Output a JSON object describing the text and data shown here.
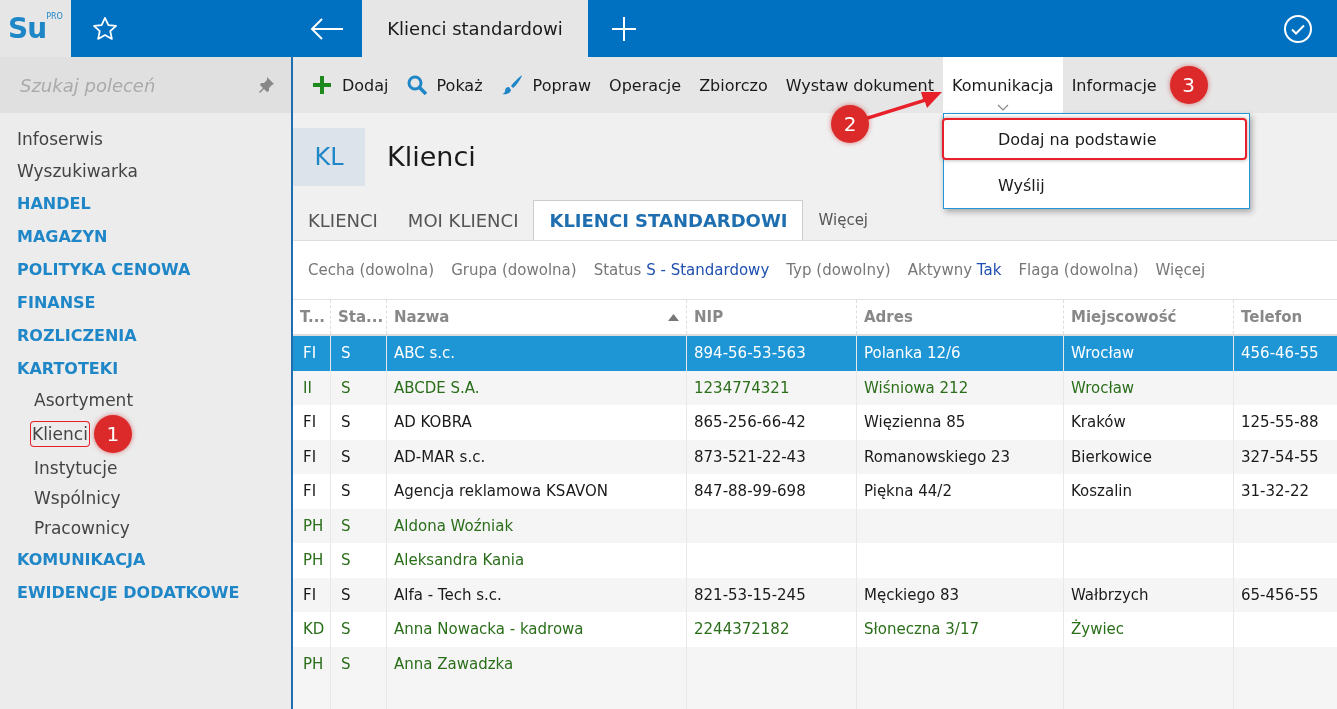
{
  "app": {
    "logo": "Su",
    "logo_sup": "PRO"
  },
  "top_tab": {
    "title": "Klienci standardowi"
  },
  "sidebar": {
    "search": {
      "placeholder": "Szukaj poleceń"
    },
    "items": [
      {
        "kind": "link",
        "label": "Infoserwis"
      },
      {
        "kind": "link",
        "label": "Wyszukiwarka"
      },
      {
        "kind": "group",
        "label": "HANDEL"
      },
      {
        "kind": "group",
        "label": "MAGAZYN"
      },
      {
        "kind": "group",
        "label": "POLITYKA CENOWA"
      },
      {
        "kind": "group",
        "label": "FINANSE"
      },
      {
        "kind": "group",
        "label": "ROZLICZENIA"
      },
      {
        "kind": "group",
        "label": "KARTOTEKI",
        "children": [
          {
            "kind": "link",
            "label": "Asortyment",
            "highlighted": false
          },
          {
            "kind": "link",
            "label": "Klienci",
            "highlighted": true,
            "step": "1"
          },
          {
            "kind": "link",
            "label": "Instytucje",
            "highlighted": false
          },
          {
            "kind": "link",
            "label": "Wspólnicy",
            "highlighted": false
          },
          {
            "kind": "link",
            "label": "Pracownicy",
            "highlighted": false
          }
        ]
      },
      {
        "kind": "group",
        "label": "KOMUNIKACJA"
      },
      {
        "kind": "group",
        "label": "EWIDENCJE DODATKOWE"
      }
    ]
  },
  "toolbar": [
    {
      "label": "Dodaj",
      "open": false
    },
    {
      "label": "Pokaż",
      "open": false
    },
    {
      "label": "Popraw",
      "open": false
    },
    {
      "label": "Operacje",
      "open": false
    },
    {
      "label": "Zbiorczo",
      "open": false
    },
    {
      "label": "Wystaw dokument",
      "open": false
    },
    {
      "label": "Komunikacja",
      "open": true,
      "step": "2"
    },
    {
      "label": "Informacje",
      "open": false,
      "step": "3"
    }
  ],
  "menu": [
    {
      "label": "Dodaj na podstawie",
      "highlighted": true
    },
    {
      "label": "Wyślij",
      "highlighted": false
    }
  ],
  "page": {
    "badge": "KL",
    "title": "Klienci"
  },
  "tabs": [
    {
      "label": "KLIENCI",
      "selected": false
    },
    {
      "label": "MOI KLIENCI",
      "selected": false
    },
    {
      "label": "KLIENCI STANDARDOWI",
      "selected": true
    },
    {
      "label": "Więcej",
      "selected": false
    }
  ],
  "filters": [
    {
      "label": "Cecha (dowolna)"
    },
    {
      "label": "Grupa (dowolna)"
    },
    {
      "label": "Status",
      "value": "S - Standardowy"
    },
    {
      "label": "Typ (dowolny)"
    },
    {
      "label": "Aktywny",
      "value": "Tak"
    },
    {
      "label": "Flaga (dowolna)"
    },
    {
      "label": "Więcej"
    }
  ],
  "table": {
    "columns": [
      {
        "label": "T..."
      },
      {
        "label": "Sta..."
      },
      {
        "label": "Nazwa",
        "sorted": true
      },
      {
        "label": "NIP"
      },
      {
        "label": "Adres"
      },
      {
        "label": "Miejscowość"
      },
      {
        "label": "Telefon"
      }
    ],
    "rows": [
      {
        "selected": true,
        "cells": [
          "FI",
          "S",
          "ABC s.c.",
          "894-56-53-563",
          "Polanka  12/6",
          "Wrocław",
          "456-46-55"
        ]
      },
      {
        "selected": false,
        "color": "#2a6e1a",
        "cells": [
          "II",
          "S",
          "ABCDE S.A.",
          "1234774321",
          "Wiśniowa 212",
          "Wrocław",
          ""
        ]
      },
      {
        "selected": false,
        "color": "#1a1a1a",
        "cells": [
          "FI",
          "S",
          "AD KOBRA",
          "865-256-66-42",
          "Więzienna  85",
          "Kraków",
          "125-55-88"
        ]
      },
      {
        "selected": false,
        "color": "#1a1a1a",
        "cells": [
          "FI",
          "S",
          "AD-MAR s.c.",
          "873-521-22-43",
          "Romanowskiego 23",
          "Bierkowice",
          "327-54-55"
        ]
      },
      {
        "selected": false,
        "color": "#1a1a1a",
        "cells": [
          "FI",
          "S",
          "Agencja reklamowa KSAVON",
          "847-88-99-698",
          "Piękna  44/2",
          "Koszalin",
          "31-32-22"
        ]
      },
      {
        "selected": false,
        "color": "#2a6e1a",
        "cells": [
          "PH",
          "S",
          "Aldona Woźniak",
          "",
          "",
          "",
          ""
        ]
      },
      {
        "selected": false,
        "color": "#2a6e1a",
        "cells": [
          "PH",
          "S",
          "Aleksandra Kania",
          "",
          "",
          "",
          ""
        ]
      },
      {
        "selected": false,
        "color": "#1a1a1a",
        "cells": [
          "FI",
          "S",
          "Alfa - Tech s.c.",
          "821-53-15-245",
          "Męckiego  83",
          "Wałbrzych",
          "65-456-55"
        ]
      },
      {
        "selected": false,
        "color": "#2a6e1a",
        "cells": [
          "KD",
          "S",
          "Anna Nowacka - kadrowa",
          "2244372182",
          "Słoneczna 3/17",
          "Żywiec",
          ""
        ]
      },
      {
        "selected": false,
        "color": "#2a6e1a",
        "cells": [
          "PH",
          "S",
          "Anna Zawadzka",
          "",
          "",
          "",
          ""
        ]
      }
    ]
  }
}
